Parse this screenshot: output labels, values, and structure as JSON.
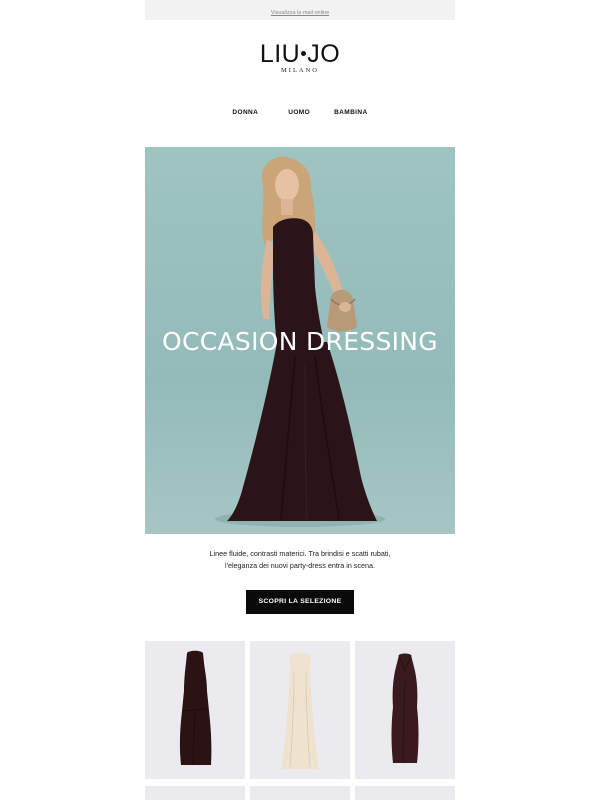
{
  "topbar": {
    "view_online": "Visualizza la mail online"
  },
  "logo": {
    "brand_left": "LIU",
    "brand_right": "JO",
    "sub": "MILANO"
  },
  "nav": {
    "items": [
      {
        "label": "DONNA"
      },
      {
        "label": "UOMO"
      },
      {
        "label": "BAMBINA"
      }
    ]
  },
  "hero": {
    "title": "OCCASION DRESSING",
    "background_color": "#9fc4c1",
    "dress_color": "#2a1418"
  },
  "intro": {
    "line1": "Linee fluide, contrasti materici. Tra brindisi e scatti rubati,",
    "line2": "l'eleganza dei nuovi party-dress entra in scena."
  },
  "cta": {
    "label": "SCOPRI LA SELEZIONE"
  },
  "products": [
    {
      "color": "#2b1214"
    },
    {
      "color": "#efe3cf"
    },
    {
      "color": "#3a1a1f"
    }
  ]
}
